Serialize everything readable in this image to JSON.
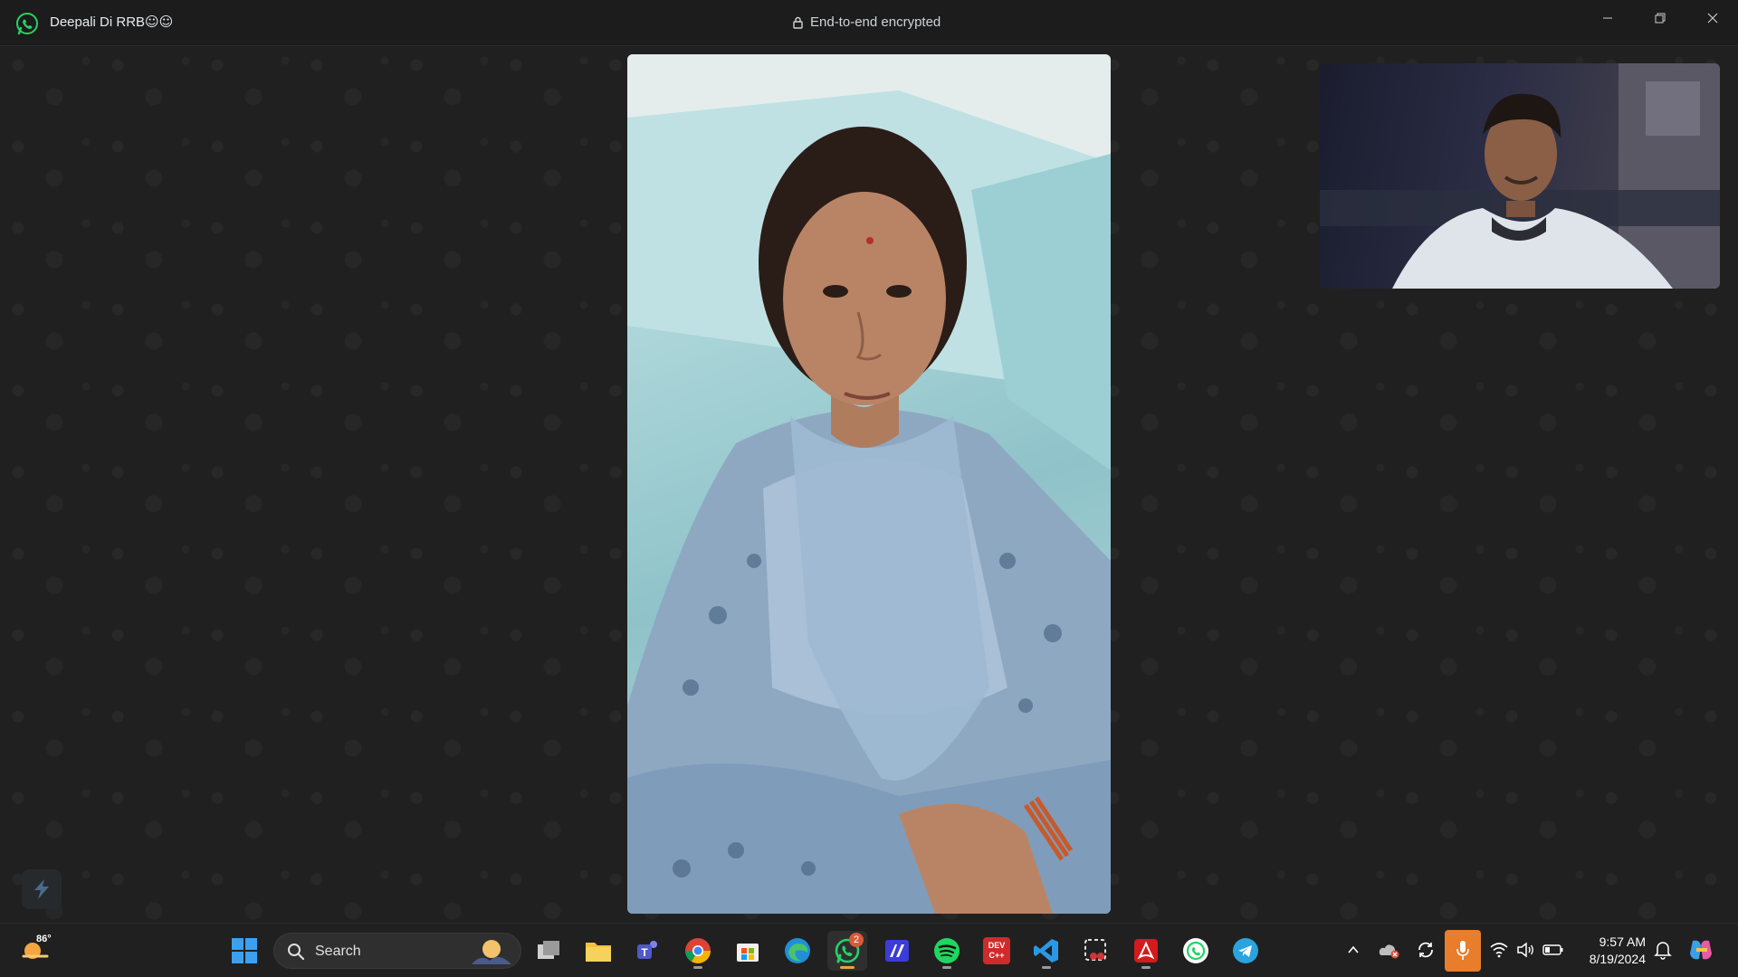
{
  "window": {
    "chat_name": "Deepali Di RRB",
    "chat_name_emoji": "☺☺",
    "encryption_label": "End-to-end encrypted",
    "controls": [
      "minimize",
      "restore",
      "close"
    ]
  },
  "call": {
    "remote_participant": "remote-video-feed",
    "self_view": "self-video-feed"
  },
  "taskbar": {
    "weather_temp": "86°",
    "search_label": "Search",
    "pinned_apps": [
      {
        "name": "start",
        "icon": "windows-logo-icon"
      },
      {
        "name": "task-view",
        "icon": "task-view-icon"
      },
      {
        "name": "file-explorer",
        "icon": "folder-icon"
      },
      {
        "name": "teams",
        "icon": "teams-icon"
      },
      {
        "name": "chrome",
        "icon": "chrome-icon"
      },
      {
        "name": "microsoft-store",
        "icon": "store-icon"
      },
      {
        "name": "edge",
        "icon": "edge-icon"
      },
      {
        "name": "whatsapp",
        "icon": "whatsapp-icon",
        "badge": "2"
      },
      {
        "name": "editor",
        "icon": "editor-icon"
      },
      {
        "name": "spotify",
        "icon": "spotify-icon"
      },
      {
        "name": "dev-cpp",
        "icon": "dev-cpp-icon",
        "label": "DEV C++"
      },
      {
        "name": "vscode",
        "icon": "vscode-icon"
      },
      {
        "name": "snipping-tool",
        "icon": "snipping-tool-icon"
      },
      {
        "name": "acrobat",
        "icon": "acrobat-icon"
      },
      {
        "name": "whatsapp-web",
        "icon": "whatsapp-circle-icon"
      },
      {
        "name": "telegram",
        "icon": "telegram-icon"
      }
    ],
    "clock_time": "9:57 AM",
    "clock_date": "8/19/2024"
  },
  "colors": {
    "whatsapp_green": "#25d366",
    "mic_active": "#e87d2b",
    "background": "#202020"
  }
}
